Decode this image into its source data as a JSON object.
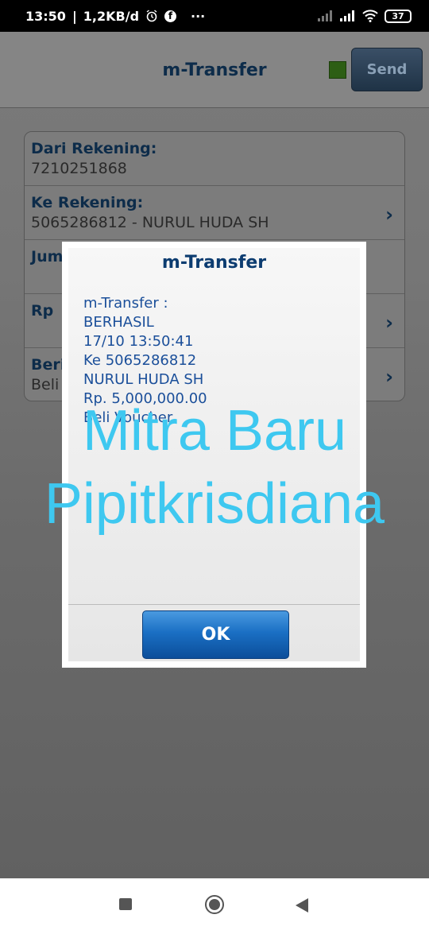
{
  "status_bar": {
    "time": "13:50",
    "net_speed": "1,2KB/d",
    "more": "···",
    "battery": "37"
  },
  "app": {
    "title": "m-Transfer",
    "send_label": "Send",
    "rows": [
      {
        "label": "Dari Rekening:",
        "value": "7210251868"
      },
      {
        "label": "Ke Rekening:",
        "value": "5065286812 - NURUL HUDA SH"
      },
      {
        "label": "Jum",
        "value": ""
      },
      {
        "label": "Rp",
        "value": ""
      },
      {
        "label": "Beri",
        "value": "Beli"
      }
    ]
  },
  "dialog": {
    "title": "m-Transfer",
    "lines": [
      "m-Transfer :",
      "BERHASIL",
      "17/10 13:50:41",
      "Ke 5065286812",
      "NURUL HUDA SH",
      "Rp. 5,000,000.00",
      "Beli Voucher"
    ],
    "ok_label": "OK"
  },
  "watermark": {
    "line1": "Mitra Baru",
    "line2": "Pipitkrisdiana"
  },
  "colors": {
    "accent": "#0c3c70",
    "watermark": "#3ec8f0",
    "ok_button": "#1a6fc4"
  }
}
